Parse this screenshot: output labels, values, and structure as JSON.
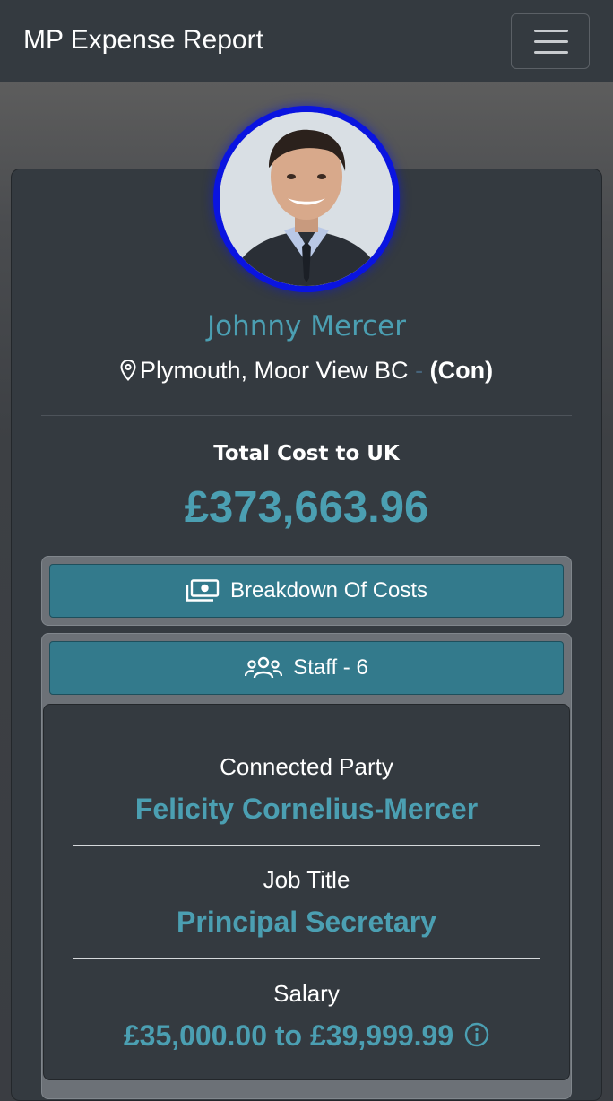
{
  "navbar": {
    "title": "MP Expense Report"
  },
  "profile": {
    "name": "Johnny Mercer",
    "constituency": "Plymouth, Moor View BC",
    "separator": "-",
    "party": "(Con)"
  },
  "totals": {
    "label": "Total Cost to UK",
    "value": "£373,663.96"
  },
  "accordion": {
    "breakdown_label": "Breakdown Of Costs",
    "staff_label": "Staff - 6"
  },
  "staff_entry": {
    "connected_party_label": "Connected Party",
    "connected_party_value": "Felicity Cornelius-Mercer",
    "job_title_label": "Job Title",
    "job_title_value": "Principal Secretary",
    "salary_label": "Salary",
    "salary_value": "£35,000.00 to £39,999.99"
  },
  "colors": {
    "accent": "#4b9fb2",
    "button": "#337a8c",
    "avatar_ring": "#0a14e0",
    "card": "#343a40"
  },
  "icons": [
    "menu-icon",
    "map-pin-icon",
    "money-icon",
    "users-icon",
    "info-icon"
  ]
}
